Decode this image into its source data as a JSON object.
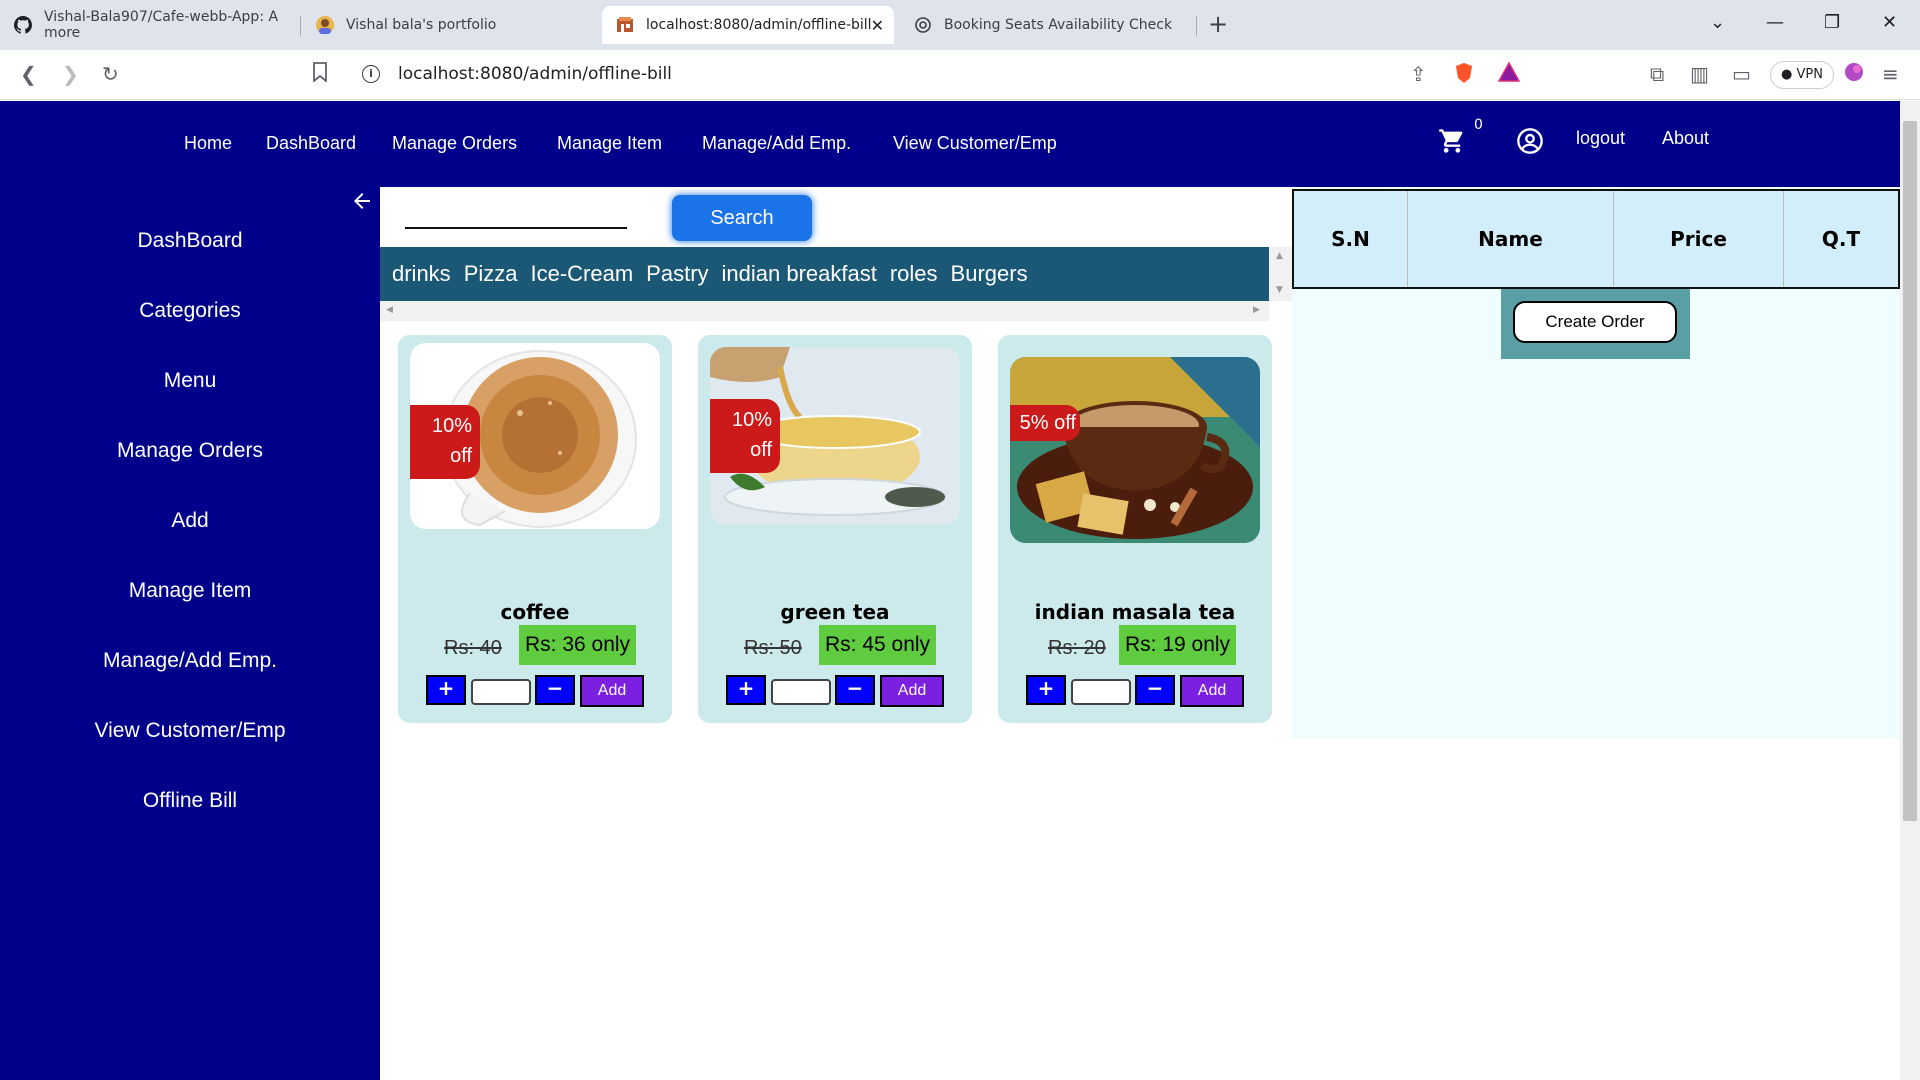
{
  "browser": {
    "tabs": [
      {
        "title": "Vishal-Bala907/Cafe-webb-App: A more",
        "icon": "github-icon"
      },
      {
        "title": "Vishal bala's portfolio",
        "icon": "avatar-icon"
      },
      {
        "title": "localhost:8080/admin/offline-bill",
        "icon": "site-icon",
        "active": true
      },
      {
        "title": "Booking Seats Availability Check",
        "icon": "openai-icon"
      }
    ],
    "url": "localhost:8080/admin/offline-bill",
    "vpn_label": "VPN"
  },
  "topnav": {
    "links": [
      "Home",
      "DashBoard",
      "Manage Orders",
      "Manage Item",
      "Manage/Add Emp.",
      "View Customer/Emp"
    ],
    "cart_count": "0",
    "logout": "logout",
    "about": "About"
  },
  "sidebar": {
    "items": [
      "DashBoard",
      "Categories",
      "Menu",
      "Manage Orders",
      "Add",
      "Manage Item",
      "Manage/Add Emp.",
      "View Customer/Emp",
      "Offline Bill"
    ]
  },
  "search": {
    "button": "Search",
    "value": ""
  },
  "categories": [
    "drinks",
    "Pizza",
    "Ice-Cream",
    "Pastry",
    "indian breakfast",
    "roles",
    "Burgers"
  ],
  "products": [
    {
      "name": "coffee",
      "discount": "10% off",
      "old_price": "Rs: 40",
      "new_price": "Rs: 36 only"
    },
    {
      "name": "green tea",
      "discount": "10% off",
      "old_price": "Rs: 50",
      "new_price": "Rs: 45 only"
    },
    {
      "name": "indian masala tea",
      "discount": "5% off",
      "old_price": "Rs: 20",
      "new_price": "Rs: 19 only"
    }
  ],
  "controls": {
    "plus": "+",
    "minus": "−",
    "add": "Add"
  },
  "order": {
    "headers": [
      "S.N",
      "Name",
      "Price",
      "Q.T"
    ],
    "create_button": "Create Order"
  }
}
